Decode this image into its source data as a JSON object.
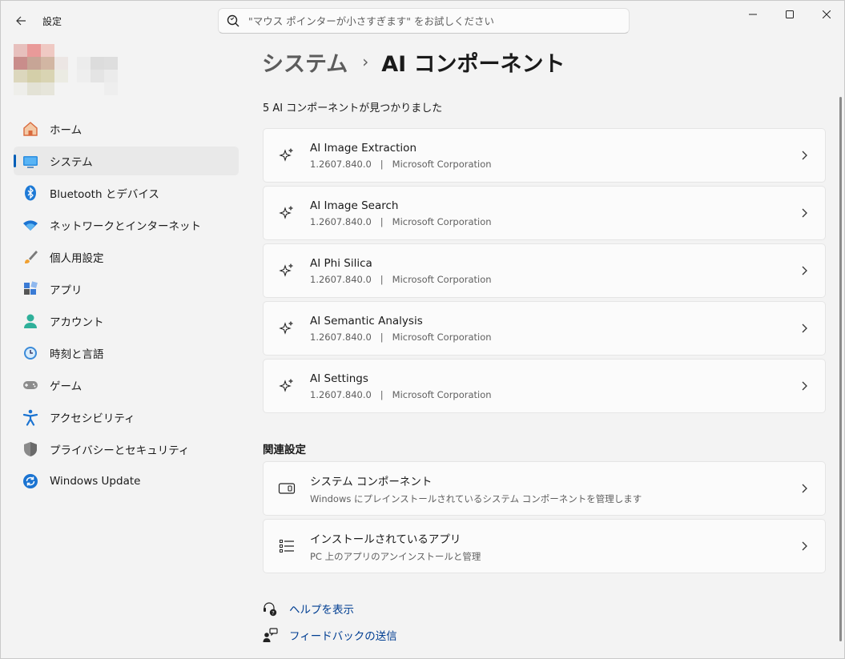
{
  "window": {
    "app_title": "設定",
    "search_placeholder": "\"マウス ポインターが小さすぎます\" をお試しください"
  },
  "sidebar": {
    "items": [
      {
        "label": "ホーム",
        "icon": "home-icon"
      },
      {
        "label": "システム",
        "icon": "system-icon",
        "active": true
      },
      {
        "label": "Bluetooth とデバイス",
        "icon": "bluetooth-icon"
      },
      {
        "label": "ネットワークとインターネット",
        "icon": "wifi-icon"
      },
      {
        "label": "個人用設定",
        "icon": "brush-icon"
      },
      {
        "label": "アプリ",
        "icon": "apps-icon"
      },
      {
        "label": "アカウント",
        "icon": "account-icon"
      },
      {
        "label": "時刻と言語",
        "icon": "time-language-icon"
      },
      {
        "label": "ゲーム",
        "icon": "gamepad-icon"
      },
      {
        "label": "アクセシビリティ",
        "icon": "accessibility-icon"
      },
      {
        "label": "プライバシーとセキュリティ",
        "icon": "shield-icon"
      },
      {
        "label": "Windows Update",
        "icon": "update-icon"
      }
    ]
  },
  "main": {
    "breadcrumb": {
      "parent": "システム",
      "separator": "›",
      "current": "AI コンポーネント"
    },
    "found_label": "5 AI コンポーネントが見つかりました",
    "components": [
      {
        "title": "AI Image Extraction",
        "version": "1.2607.840.0",
        "sep": "|",
        "publisher": "Microsoft Corporation"
      },
      {
        "title": "AI Image Search",
        "version": "1.2607.840.0",
        "sep": "|",
        "publisher": "Microsoft Corporation"
      },
      {
        "title": "AI Phi Silica",
        "version": "1.2607.840.0",
        "sep": "|",
        "publisher": "Microsoft Corporation"
      },
      {
        "title": "AI Semantic Analysis",
        "version": "1.2607.840.0",
        "sep": "|",
        "publisher": "Microsoft Corporation"
      },
      {
        "title": "AI Settings",
        "version": "1.2607.840.0",
        "sep": "|",
        "publisher": "Microsoft Corporation"
      }
    ],
    "related_title": "関連設定",
    "related": [
      {
        "title": "システム コンポーネント",
        "subtitle": "Windows にプレインストールされているシステム コンポーネントを管理します",
        "icon": "system-component-icon"
      },
      {
        "title": "インストールされているアプリ",
        "subtitle": "PC 上のアプリのアンインストールと管理",
        "icon": "installed-apps-icon"
      }
    ],
    "links": [
      {
        "label": "ヘルプを表示",
        "icon": "help-icon"
      },
      {
        "label": "フィードバックの送信",
        "icon": "feedback-icon"
      }
    ]
  },
  "colors": {
    "accent": "#005fb8",
    "link": "#003e92",
    "background": "#f3f3f3",
    "card": "#fbfbfb"
  }
}
